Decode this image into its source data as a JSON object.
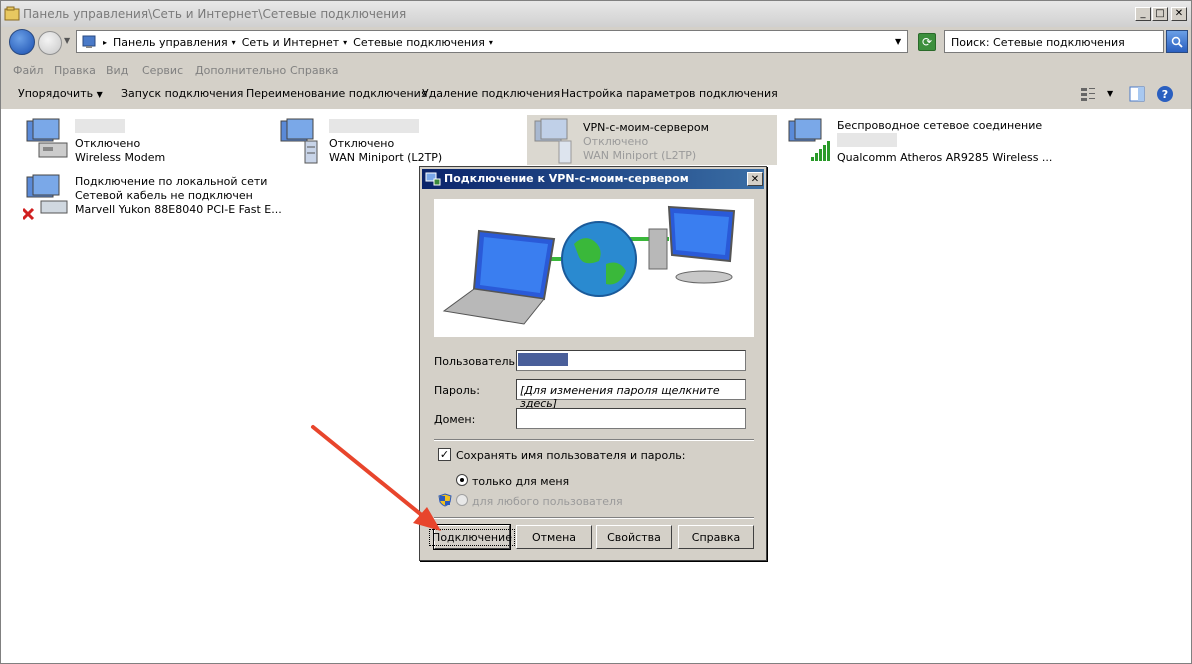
{
  "window": {
    "title": "Панель управления\\Сеть и Интернет\\Сетевые подключения",
    "minimize": "_",
    "maximize": "□",
    "close": "✕"
  },
  "address": {
    "crumbs": [
      "Панель управления",
      "Сеть и Интернет",
      "Сетевые подключения"
    ],
    "search_placeholder": "Поиск: Сетевые подключения"
  },
  "menu": [
    "Файл",
    "Правка",
    "Вид",
    "Сервис",
    "Дополнительно",
    "Справка"
  ],
  "toolbar": {
    "organize": "Упорядочить",
    "start_conn": "Запуск подключения",
    "rename_conn": "Переименование подключения",
    "delete_conn": "Удаление подключения",
    "settings_conn": "Настройка параметров подключения"
  },
  "connections": [
    {
      "status": "Отключено",
      "device": "Wireless Modem"
    },
    {
      "status": "Отключено",
      "device": "WAN Miniport (L2TP)"
    },
    {
      "name": "VPN-с-моим-сервером",
      "status": "Отключено",
      "device": "WAN Miniport (L2TP)"
    },
    {
      "name": "Беспроводное сетевое соединение",
      "device": "Qualcomm Atheros AR9285 Wireless ..."
    },
    {
      "name": "Подключение по локальной сети",
      "status": "Сетевой кабель не подключен",
      "device": "Marvell Yukon 88E8040 PCI-E Fast E..."
    }
  ],
  "dialog": {
    "title": "Подключение к VPN-с-моим-сервером",
    "user_label": "Пользователь:",
    "password_label": "Пароль:",
    "password_hint": "[Для изменения пароля щелкните здесь]",
    "domain_label": "Домен:",
    "save_label": "Сохранять имя пользователя и пароль:",
    "only_me": "только для меня",
    "any_user": "для любого пользователя",
    "btn_connect": "Подключение",
    "btn_cancel": "Отмена",
    "btn_properties": "Свойства",
    "btn_help": "Справка",
    "close": "✕"
  },
  "colors": {
    "title_grad_start": "#0a246a",
    "title_grad_end": "#3a6ea5",
    "arrow": "#e8452c"
  }
}
